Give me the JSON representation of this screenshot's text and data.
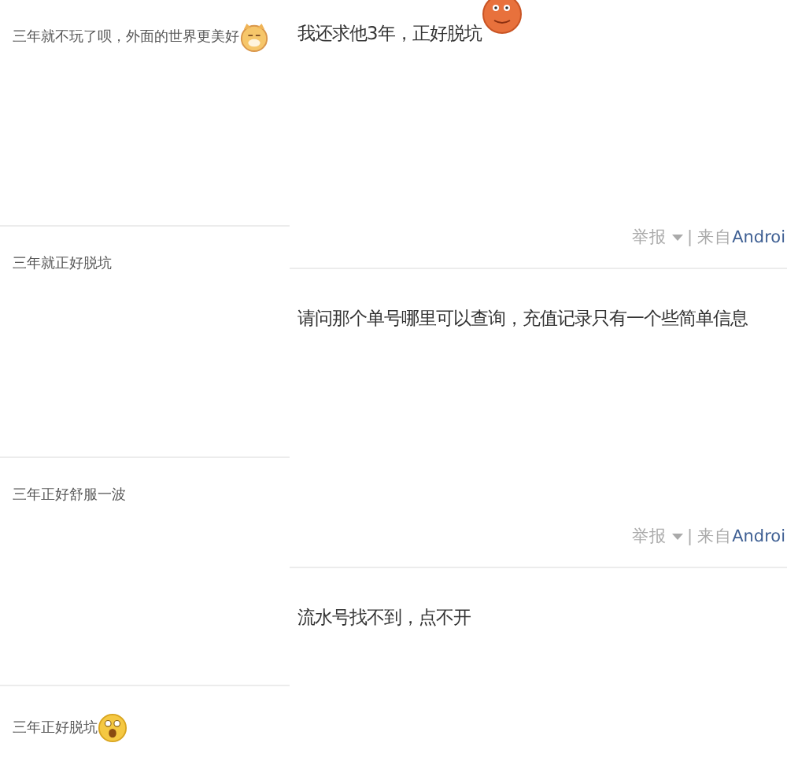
{
  "left_comments": [
    {
      "text": "三年就不玩了呗，外面的世界更美好",
      "kind": "cat"
    },
    {
      "text": "三年就正好脱坑",
      "kind": "plain"
    },
    {
      "text": "三年正好舒服一波",
      "kind": "plain"
    },
    {
      "text": "三年正好脱坑",
      "kind": "surprised"
    }
  ],
  "posts": [
    {
      "text": "我还求他3年，正好脱坑",
      "kind": "orange",
      "footer": {
        "report": "举报",
        "separator": "|",
        "source_label": "来自",
        "source": "Androi"
      }
    },
    {
      "text": "请问那个单号哪里可以查询，充值记录只有一个些简单信息",
      "kind": "plain",
      "footer": {
        "report": "举报",
        "separator": "|",
        "source_label": "来自",
        "source": "Androi"
      }
    },
    {
      "text": "流水号找不到，点不开",
      "kind": "plain"
    }
  ]
}
